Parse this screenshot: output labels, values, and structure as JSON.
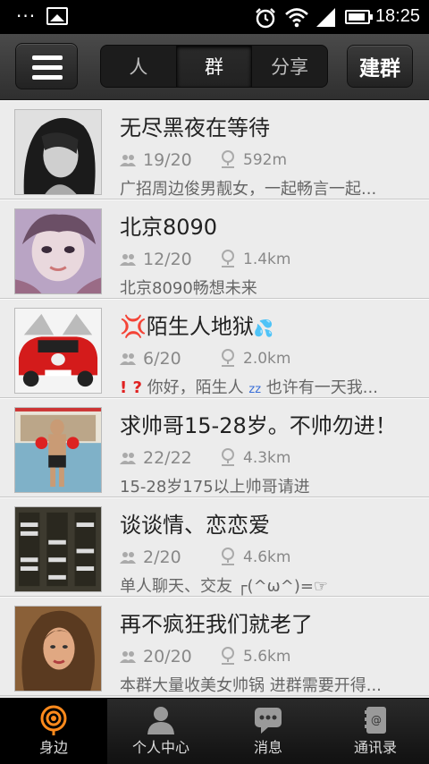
{
  "status_bar": {
    "time": "18:25"
  },
  "header": {
    "tabs": [
      {
        "label": "人"
      },
      {
        "label": "群"
      },
      {
        "label": "分享"
      }
    ],
    "active_tab": "群",
    "create_label": "建群"
  },
  "groups": [
    {
      "name": "无尽黑夜在等待",
      "count": "19/20",
      "distance": "592m",
      "desc": "广招周边俊男靓女，一起畅言一起..."
    },
    {
      "name": "北京8090",
      "count": "12/20",
      "distance": "1.4km",
      "desc": "北京8090畅想未来"
    },
    {
      "name": "陌生人地狱",
      "count": "6/20",
      "distance": "2.0km",
      "desc": "你好，陌生人",
      "desc2": "也许有一天我..."
    },
    {
      "name": "求帅哥15-28岁。不帅勿进！",
      "count": "22/22",
      "distance": "4.3km",
      "desc": "15-28岁175以上帅哥请进"
    },
    {
      "name": "谈谈情、恋恋爱",
      "count": "2/20",
      "distance": "4.6km",
      "desc": "单人聊天、交友 ┌(^ω^)=☞"
    },
    {
      "name": "再不疯狂我们就老了",
      "count": "20/20",
      "distance": "5.6km",
      "desc": "本群大量收美女帅锅 进群需要开得..."
    }
  ],
  "bottom_nav": [
    {
      "label": "身边",
      "icon": "nearby-icon"
    },
    {
      "label": "个人中心",
      "icon": "person-icon"
    },
    {
      "label": "消息",
      "icon": "message-icon"
    },
    {
      "label": "通讯录",
      "icon": "contacts-icon"
    }
  ],
  "colors": {
    "accent": "#ff8a1c",
    "header_bg": "#3a3a3a",
    "list_bg": "#ececec"
  }
}
